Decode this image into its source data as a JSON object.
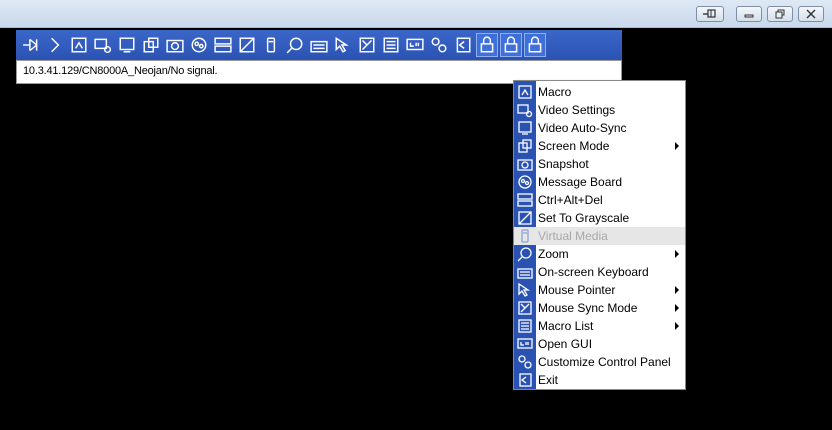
{
  "window": {
    "controls": [
      "pin",
      "minimize",
      "maximize",
      "close"
    ]
  },
  "toolbar": {
    "icons": [
      "pin-icon",
      "arrow-icon",
      "macro-icon",
      "video-settings-icon",
      "video-auto-sync-icon",
      "screen-mode-icon",
      "snapshot-icon",
      "message-board-icon",
      "ctrl-alt-del-icon",
      "grayscale-icon",
      "virtual-media-icon",
      "zoom-icon",
      "keyboard-icon",
      "mouse-pointer-icon",
      "mouse-sync-icon",
      "macro-list-icon",
      "open-gui-icon",
      "control-panel-icon",
      "exit-icon",
      "lock-icon",
      "lock-icon",
      "lock-icon"
    ]
  },
  "status": {
    "text": "10.3.41.129/CN8000A_Neojan/No signal."
  },
  "menu": {
    "items": [
      {
        "label": "Macro",
        "submenu": false,
        "disabled": false,
        "icon": "macro-icon"
      },
      {
        "label": "Video Settings",
        "submenu": false,
        "disabled": false,
        "icon": "video-settings-icon"
      },
      {
        "label": "Video Auto-Sync",
        "submenu": false,
        "disabled": false,
        "icon": "video-auto-sync-icon"
      },
      {
        "label": "Screen Mode",
        "submenu": true,
        "disabled": false,
        "icon": "screen-mode-icon"
      },
      {
        "label": "Snapshot",
        "submenu": false,
        "disabled": false,
        "icon": "snapshot-icon"
      },
      {
        "label": "Message Board",
        "submenu": false,
        "disabled": false,
        "icon": "message-board-icon"
      },
      {
        "label": "Ctrl+Alt+Del",
        "submenu": false,
        "disabled": false,
        "icon": "ctrl-alt-del-icon"
      },
      {
        "label": "Set To Grayscale",
        "submenu": false,
        "disabled": false,
        "icon": "grayscale-icon"
      },
      {
        "label": "Virtual Media",
        "submenu": false,
        "disabled": true,
        "icon": "virtual-media-icon"
      },
      {
        "label": "Zoom",
        "submenu": true,
        "disabled": false,
        "icon": "zoom-icon"
      },
      {
        "label": "On-screen Keyboard",
        "submenu": false,
        "disabled": false,
        "icon": "keyboard-icon"
      },
      {
        "label": "Mouse Pointer",
        "submenu": true,
        "disabled": false,
        "icon": "mouse-pointer-icon"
      },
      {
        "label": "Mouse Sync Mode",
        "submenu": true,
        "disabled": false,
        "icon": "mouse-sync-icon"
      },
      {
        "label": "Macro List",
        "submenu": true,
        "disabled": false,
        "icon": "macro-list-icon"
      },
      {
        "label": "Open GUI",
        "submenu": false,
        "disabled": false,
        "icon": "open-gui-icon"
      },
      {
        "label": "Customize Control Panel",
        "submenu": false,
        "disabled": false,
        "icon": "control-panel-icon"
      },
      {
        "label": "Exit",
        "submenu": false,
        "disabled": false,
        "icon": "exit-icon"
      }
    ]
  },
  "colors": {
    "toolbar": "#2a52b3",
    "menu_strip": "#2a52b3",
    "disabled_text": "#a8a8a8"
  }
}
